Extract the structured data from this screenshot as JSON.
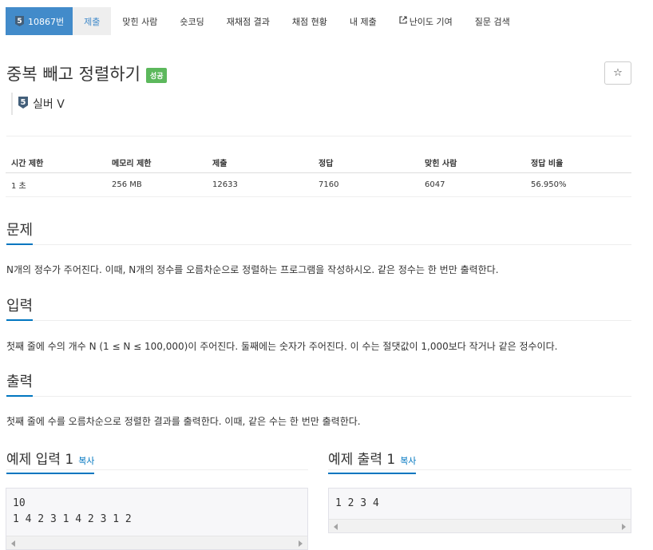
{
  "nav": {
    "tier_number": "5",
    "problem_id": "10867번",
    "items": [
      {
        "label": "제출"
      },
      {
        "label": "맞힌 사람"
      },
      {
        "label": "숏코딩"
      },
      {
        "label": "재채점 결과"
      },
      {
        "label": "채점 현황"
      },
      {
        "label": "내 제출"
      },
      {
        "label": "난이도 기여"
      },
      {
        "label": "질문 검색"
      }
    ]
  },
  "problem": {
    "title": "중복 빼고 정렬하기",
    "result_badge": "성공",
    "star": "☆",
    "tier_number": "5",
    "tier_label": "실버 V"
  },
  "info": {
    "headers": [
      "시간 제한",
      "메모리 제한",
      "제출",
      "정답",
      "맞힌 사람",
      "정답 비율"
    ],
    "values": [
      "1 초",
      "256 MB",
      "12633",
      "7160",
      "6047",
      "56.950%"
    ]
  },
  "sections": {
    "problem_heading": "문제",
    "problem_text": "N개의 정수가 주어진다. 이때, N개의 정수를 오름차순으로 정렬하는 프로그램을 작성하시오. 같은 정수는 한 번만 출력한다.",
    "input_heading": "입력",
    "input_text": "첫째 줄에 수의 개수 N (1 ≤ N ≤ 100,000)이 주어진다. 둘째에는 숫자가 주어진다. 이 수는 절댓값이 1,000보다 작거나 같은 정수이다.",
    "output_heading": "출력",
    "output_text": "첫째 줄에 수를 오름차순으로 정렬한 결과를 출력한다. 이때, 같은 수는 한 번만 출력한다."
  },
  "samples": {
    "input_heading": "예제 입력 1",
    "output_heading": "예제 출력 1",
    "copy_label": "복사",
    "input_text": "10\n1 4 2 3 1 4 2 3 1 2",
    "output_text": "1 2 3 4"
  },
  "colors": {
    "nav_active_bg": "#428bca",
    "accent_blue": "#0076c0",
    "success_green": "#5cb85c"
  },
  "icons": {
    "tier": "silver-tier-5-icon",
    "external_link": "external-link-icon",
    "star": "star-outline-icon"
  }
}
